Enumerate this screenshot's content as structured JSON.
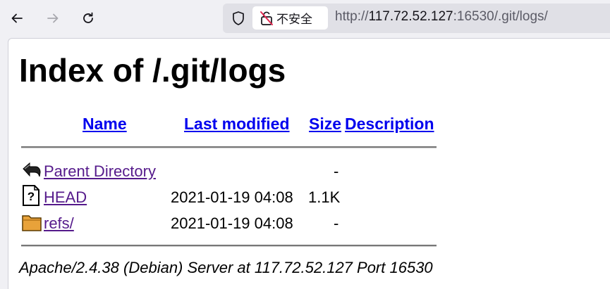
{
  "browser": {
    "security_label": "不安全",
    "url": {
      "scheme": "http://",
      "host": "117.72.52.127",
      "rest": ":16530/.git/logs/"
    },
    "icons": {
      "back": "arrow-left-icon",
      "forward": "arrow-right-icon",
      "reload": "reload-icon",
      "tracking": "shield-icon",
      "insecure": "broken-lock-icon"
    }
  },
  "page": {
    "title": "Index of /.git/logs",
    "columns": {
      "name": "Name",
      "last_modified": "Last modified",
      "size": "Size",
      "description": "Description"
    },
    "rows": [
      {
        "icon": "back-arrow-icon",
        "name": "Parent Directory",
        "modified": "",
        "size": "-"
      },
      {
        "icon": "unknown-file-icon",
        "name": "HEAD",
        "modified": "2021-01-19 04:08",
        "size": "1.1K"
      },
      {
        "icon": "folder-icon",
        "name": "refs/",
        "modified": "2021-01-19 04:08",
        "size": "-"
      }
    ],
    "signature": "Apache/2.4.38 (Debian) Server at 117.72.52.127 Port 16530"
  },
  "colors": {
    "link": "#0000ee",
    "visited_link": "#551a8b",
    "toolbar_bg": "#f0f0f4"
  }
}
